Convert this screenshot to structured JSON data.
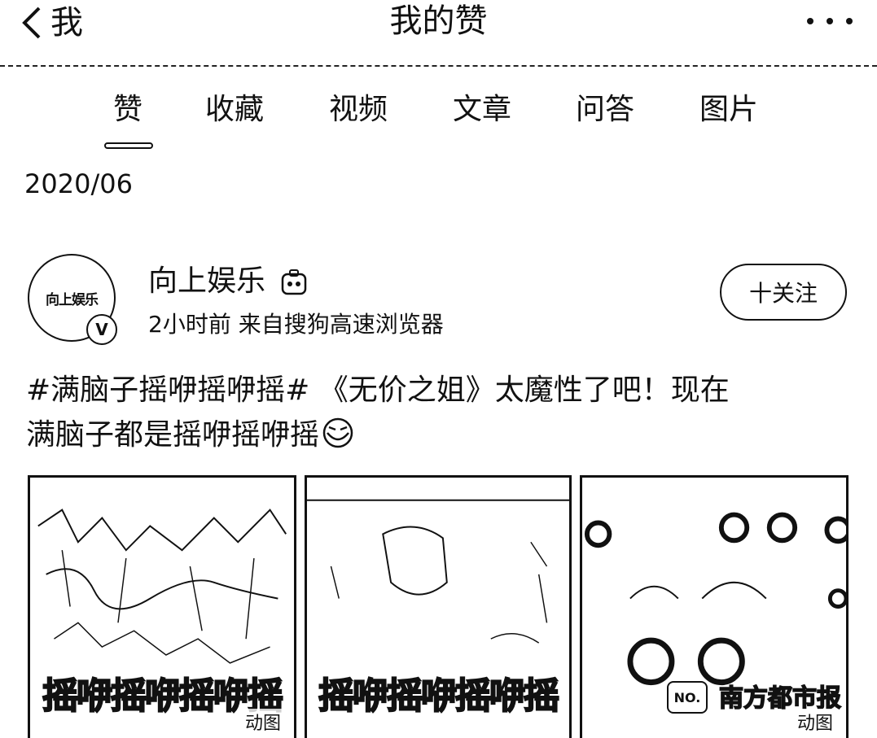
{
  "navbar": {
    "back_label": "我",
    "title": "我的赞",
    "more_icon": "more-dots-icon"
  },
  "tabs": [
    {
      "label": "赞",
      "active": true
    },
    {
      "label": "收藏",
      "active": false
    },
    {
      "label": "视频",
      "active": false
    },
    {
      "label": "文章",
      "active": false
    },
    {
      "label": "问答",
      "active": false
    },
    {
      "label": "图片",
      "active": false
    }
  ],
  "date_header": "2020/06",
  "post": {
    "author": {
      "name": "向上娱乐",
      "avatar_text": "向上娱乐",
      "verified_badge": "V",
      "meta": "2小时前  来自搜狗高速浏览器"
    },
    "follow_label": "十关注",
    "text_line1": "#满脑子摇咿摇咿摇# 《无价之姐》太魔性了吧！现在",
    "text_line2": "满脑子都是摇咿摇咿摇",
    "images": [
      {
        "caption": "摇咿摇咿摇咿摇",
        "tag": "动图"
      },
      {
        "caption": "摇咿摇咿摇咿摇",
        "tag": "动图"
      },
      {
        "caption": "",
        "watermark": "南方都市报",
        "tag": "动图"
      }
    ]
  }
}
